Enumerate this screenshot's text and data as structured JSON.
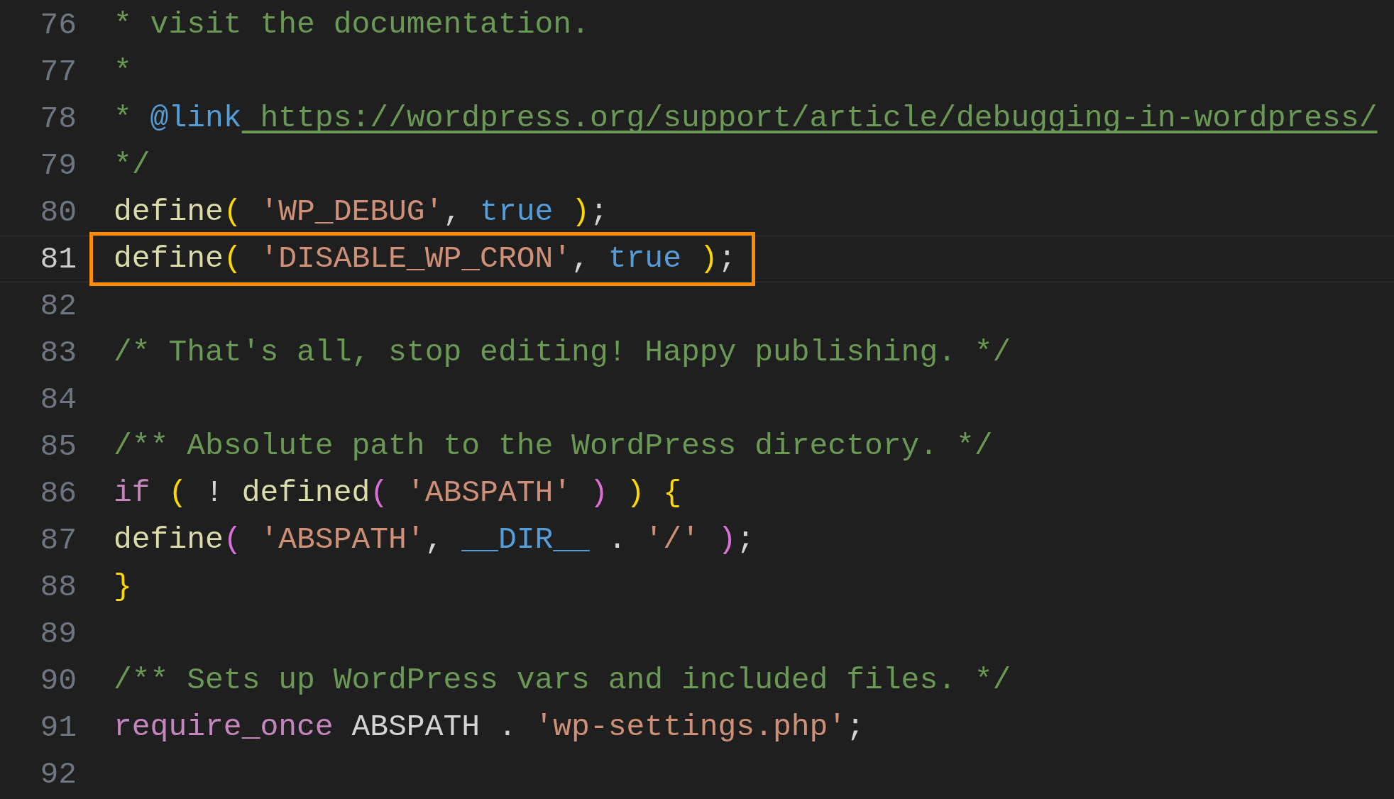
{
  "editor": {
    "lines": [
      {
        "number": "76",
        "tokens": [
          {
            "text": "* visit the documentation.",
            "kind": "comment"
          }
        ]
      },
      {
        "number": "77",
        "tokens": [
          {
            "text": "*",
            "kind": "comment"
          }
        ]
      },
      {
        "number": "78",
        "tokens": [
          {
            "text": "* ",
            "kind": "comment"
          },
          {
            "text": "@link",
            "kind": "doctag"
          },
          {
            "text": " https://wordpress.org/support/article/debugging-in-wordpress/",
            "kind": "link"
          }
        ]
      },
      {
        "number": "79",
        "tokens": [
          {
            "text": "*/",
            "kind": "comment"
          }
        ]
      },
      {
        "number": "80",
        "tokens": [
          {
            "text": "define",
            "kind": "function"
          },
          {
            "text": "( ",
            "kind": "bracket1"
          },
          {
            "text": "'WP_DEBUG'",
            "kind": "string"
          },
          {
            "text": ", ",
            "kind": "plain"
          },
          {
            "text": "true ",
            "kind": "constant"
          },
          {
            "text": ")",
            "kind": "bracket1"
          },
          {
            "text": ";",
            "kind": "plain"
          }
        ]
      },
      {
        "number": "81",
        "current": true,
        "highlighted": true,
        "tokens": [
          {
            "text": "define",
            "kind": "function"
          },
          {
            "text": "( ",
            "kind": "bracket1"
          },
          {
            "text": "'DISABLE_WP_CRON'",
            "kind": "string"
          },
          {
            "text": ", ",
            "kind": "plain"
          },
          {
            "text": "true ",
            "kind": "constant"
          },
          {
            "text": ")",
            "kind": "bracket1"
          },
          {
            "text": ";",
            "kind": "plain"
          }
        ]
      },
      {
        "number": "82"
      },
      {
        "number": "83",
        "tokens": [
          {
            "text": "/* That's all, stop editing! Happy publishing. */",
            "kind": "comment"
          }
        ]
      },
      {
        "number": "84"
      },
      {
        "number": "85",
        "tokens": [
          {
            "text": "/** Absolute path to the WordPress directory. */",
            "kind": "comment"
          }
        ]
      },
      {
        "number": "86",
        "tokens": [
          {
            "text": "if ",
            "kind": "keyword"
          },
          {
            "text": "(",
            "kind": "bracket1"
          },
          {
            "text": " ! ",
            "kind": "plain"
          },
          {
            "text": "defined",
            "kind": "function"
          },
          {
            "text": "( ",
            "kind": "bracket2"
          },
          {
            "text": "'ABSPATH' ",
            "kind": "string"
          },
          {
            "text": ") ",
            "kind": "bracket2"
          },
          {
            "text": ") {",
            "kind": "bracket1"
          }
        ]
      },
      {
        "number": "87",
        "tokens": [
          {
            "text": "define",
            "kind": "function"
          },
          {
            "text": "( ",
            "kind": "bracket2"
          },
          {
            "text": "'ABSPATH'",
            "kind": "string"
          },
          {
            "text": ", ",
            "kind": "plain"
          },
          {
            "text": "__DIR__",
            "kind": "constant"
          },
          {
            "text": " . ",
            "kind": "plain"
          },
          {
            "text": "'/' ",
            "kind": "string"
          },
          {
            "text": ")",
            "kind": "bracket2"
          },
          {
            "text": ";",
            "kind": "plain"
          }
        ]
      },
      {
        "number": "88",
        "tokens": [
          {
            "text": "}",
            "kind": "bracket1"
          }
        ]
      },
      {
        "number": "89"
      },
      {
        "number": "90",
        "tokens": [
          {
            "text": "/** Sets up WordPress vars and included files. */",
            "kind": "comment"
          }
        ]
      },
      {
        "number": "91",
        "tokens": [
          {
            "text": "require_once",
            "kind": "keyword"
          },
          {
            "text": " ABSPATH . ",
            "kind": "plain"
          },
          {
            "text": "'wp-settings.php'",
            "kind": "string"
          },
          {
            "text": ";",
            "kind": "plain"
          }
        ]
      },
      {
        "number": "92"
      }
    ]
  }
}
